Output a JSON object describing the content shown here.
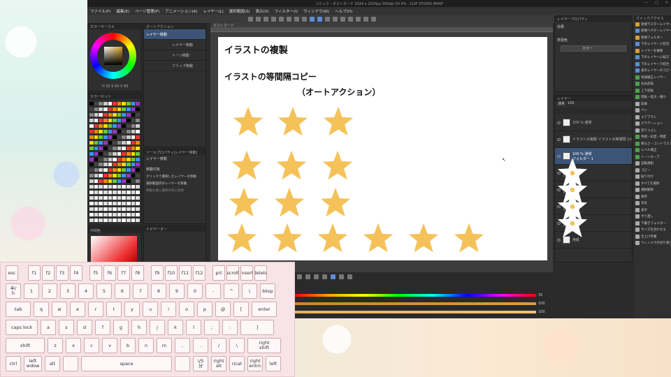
{
  "app": {
    "title": "コミック・ポストカード 2024 x 1024px 350dpi 50.0% - CLIP STUDIO PAINT",
    "window_controls": [
      "ー",
      "□",
      "×"
    ],
    "menu": [
      "ファイル(F)",
      "編集(E)",
      "ページ管理(P)",
      "アニメーション(A)",
      "レイヤー(L)",
      "選択範囲(S)",
      "表示(V)",
      "フィルター(I)",
      "ウィンドウ(W)",
      "ヘルプ(H)"
    ]
  },
  "left_panels": {
    "color_wheel_head": "カラーサークル",
    "color_values": "H 30  S 60  V 95",
    "color_set_head": "カラーセット",
    "color_set_select": "カラー",
    "intermediate_head": "中間色"
  },
  "auto_action": {
    "head": "オートアクション",
    "items": [
      "レイヤー移動",
      "レイヤー移動",
      "トーン移動",
      "フリップ移動"
    ]
  },
  "tool_property": {
    "head": "ツールプロパティ[レイヤー移動]",
    "name": "レイヤー移動",
    "target_label": "移動対象",
    "options": [
      "クリックで選択したレイヤーを移動",
      "選択範囲内のレイヤーを移動",
      "移動も後に選択の色に変更"
    ]
  },
  "navigator_head": "ナビゲーター",
  "canvas": {
    "tab": "ポストカード",
    "title": "イラストの複製",
    "subtitle": "イラストの等間隔コピー",
    "subtitle2": "（オートアクション）",
    "cursor": "↖"
  },
  "layer_property": {
    "head": "レイヤープロパティ",
    "effect_label": "効果",
    "color_label": "表現色",
    "color_value": "カラー"
  },
  "layers": {
    "head": "レイヤー",
    "blend": "通常",
    "opacity": "100",
    "rows": [
      {
        "label": "100 % 通常",
        "sub": "",
        "selected": false
      },
      {
        "label": "イラストの複製  イラストの等間隔コピー",
        "sub": "",
        "selected": false
      },
      {
        "label": "100 % 通常",
        "sub": "フォルダー 1",
        "selected": true
      },
      {
        "label": "100 % 通常",
        "sub": "レイヤー 1",
        "selected": false
      },
      {
        "label": "100 % 通常",
        "sub": "レイヤー 1",
        "selected": false
      },
      {
        "label": "100 % 通常",
        "sub": "レイヤー 1",
        "selected": false
      },
      {
        "label": "100 % 通常",
        "sub": "レイヤー 1",
        "selected": false
      },
      {
        "label": "",
        "sub": "用紙",
        "selected": false
      }
    ]
  },
  "right_tools": {
    "head": "クイックアクセス",
    "items": [
      "新規ラスターレイヤー",
      "新規ベクターレイヤー",
      "新規フォルダー",
      "下のレイヤーと結合",
      "レイヤーを複製",
      "下のレイヤーに転写",
      "下のレイヤーで結合",
      "表示レイヤーのコピー",
      "色調補正レイヤー",
      "左右反転",
      "上下反転",
      "回転・拡大・縮小",
      "鉛筆",
      "ペン",
      "エアブラシ",
      "グラデーション",
      "塗りつぶし",
      "色相・彩度・明度",
      "明るさ・コントラスト",
      "レベル補正",
      "トーンカーブ",
      "自動選択",
      "コピー",
      "貼り付け",
      "すべてを選択",
      "選択解除",
      "保存",
      "消去",
      "表示",
      "やり直し",
      "下書きフォルダー",
      "サイズを合わせる",
      "仕上げ作業",
      "ウィンドウの切り替え"
    ],
    "colors": [
      "#d9a030",
      "#5a8fd6",
      "#d9a030",
      "#5a8fd6",
      "#d9a030",
      "#5a8fd6",
      "#5a8fd6",
      "#5a8fd6",
      "#4fa04f",
      "#4fa04f",
      "#4fa04f",
      "#4fa04f",
      "#aaaaaa",
      "#aaaaaa",
      "#aaaaaa",
      "#aaaaaa",
      "#aaaaaa",
      "#4fa04f",
      "#4fa04f",
      "#4fa04f",
      "#4fa04f",
      "#aaaaaa",
      "#aaaaaa",
      "#aaaaaa",
      "#aaaaaa",
      "#aaaaaa",
      "#aaaaaa",
      "#aaaaaa",
      "#aaaaaa",
      "#aaaaaa",
      "#aaaaaa",
      "#aaaaaa",
      "#aaaaaa",
      "#aaaaaa"
    ]
  },
  "sliders": [
    {
      "value": "35",
      "color": "rainbow"
    },
    {
      "value": "100",
      "color": "#d9a030"
    },
    {
      "value": "100",
      "color": "#e8b060"
    }
  ],
  "keyboard": {
    "rows": [
      [
        "esc",
        "f1",
        "f2",
        "f3",
        "f4",
        "f5",
        "f6",
        "f7",
        "f8",
        "f9",
        "f10",
        "f11",
        "f12",
        "prt",
        "scroll",
        "insert",
        "delete"
      ],
      [
        "半/\nh",
        "1",
        "2",
        "3",
        "4",
        "5",
        "6",
        "7",
        "8",
        "9",
        "0",
        "-",
        "^",
        "\\",
        "bksp"
      ],
      [
        "tab",
        "q",
        "w",
        "e",
        "r",
        "t",
        "y",
        "u",
        "i",
        "o",
        "p",
        "@",
        "[",
        "enter"
      ],
      [
        "caps lock",
        "a",
        "s",
        "d",
        "f",
        "g",
        "h",
        "j",
        "k",
        "l",
        ";",
        ":",
        "]"
      ],
      [
        "shift",
        "z",
        "x",
        "c",
        "v",
        "b",
        "n",
        "m",
        ",",
        ".",
        "/",
        "\\",
        "right\nshift"
      ],
      [
        "ctrl",
        "left\nwdow",
        "alt",
        "",
        "space",
        "",
        "\\/S\n分",
        "right\nalt",
        "ricat",
        "right\nentrn",
        "left"
      ]
    ]
  }
}
